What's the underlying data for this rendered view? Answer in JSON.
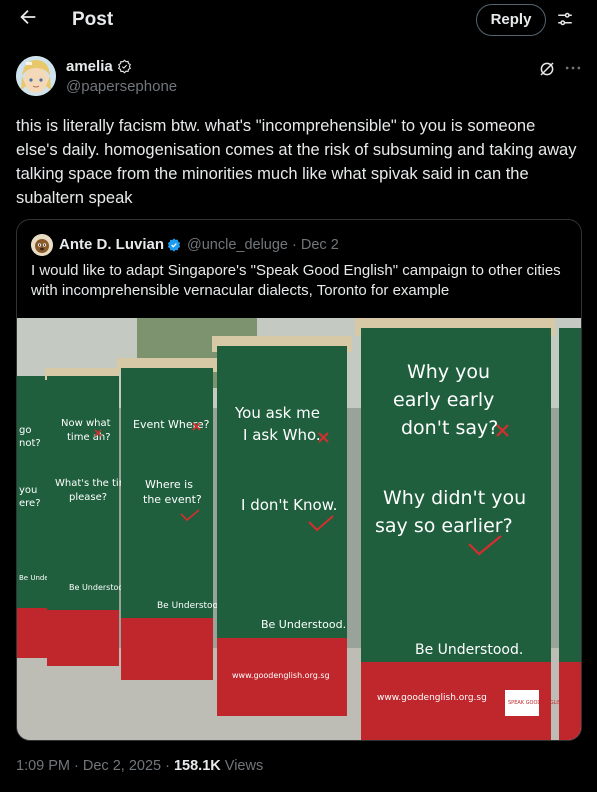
{
  "header": {
    "title": "Post",
    "reply_label": "Reply",
    "back_icon": "arrow-left-icon",
    "settings_icon": "sliders-icon"
  },
  "post": {
    "author_name": "amelia",
    "author_handle": "@papersephone",
    "text": "this is literally facism btw. what's \"incomprehensible\" to you is someone else's daily. homogenisation comes at the risk of subsuming and taking away talking space from the minorities much like what spivak said in can the subaltern speak",
    "time": "1:09 PM",
    "date": "Dec 2, 2025",
    "views_count": "158.1K",
    "views_label": "Views"
  },
  "quote": {
    "author_name": "Ante D. Luvian",
    "author_handle": "@uncle_deluge",
    "date": "Dec 2",
    "text": "I would like to adapt Singapore's \"Speak Good English\" campaign to other cities with incomprehensible vernacular dialects, Toronto for example"
  },
  "image": {
    "banner1": {
      "l1": "You ask me",
      "l2": "I ask Who.",
      "l3": "I don't Know.",
      "l4": "Be Understood.",
      "url": "www.goodenglish.org.sg"
    },
    "banner2": {
      "l1": "Why you",
      "l2": "early early",
      "l3": "don't say?",
      "l4": "Why didn't you",
      "l5": "say so earlier?",
      "l6": "Be Understood.",
      "url": "www.goodenglish.org.sg",
      "logo": "SPEAK GOOD ENGLISH"
    },
    "banner3": {
      "l1": "Event Where?",
      "l2": "Where is",
      "l3": "the event?",
      "l4": "Be Understood."
    },
    "banner4": {
      "l1": "Now what",
      "l2": "time ah?",
      "l3": "What's the time,",
      "l4": "please?",
      "l5": "Be Understood."
    },
    "banner5": {
      "l1": "go",
      "l2": "not?",
      "l3": "you",
      "l4": "ere?",
      "l5": "Be Understood."
    },
    "colors": {
      "board": "#1f5f3d",
      "base": "#c0272d",
      "frame": "#d8c9a6"
    }
  },
  "colors": {
    "background": "#000000",
    "text": "#e7e9ea",
    "muted": "#71767b",
    "border": "#2f3336",
    "verified": "#1d9bf0"
  }
}
